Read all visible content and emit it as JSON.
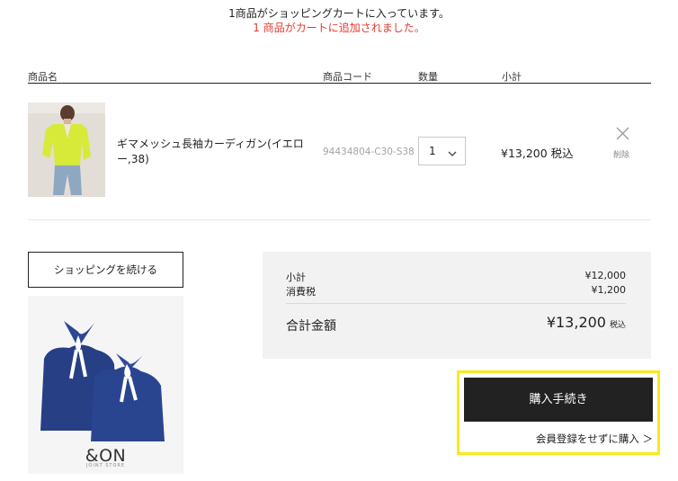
{
  "messages": {
    "items_in_cart": "1商品がショッピングカートに入っています。",
    "added_to_cart": "1 商品がカートに追加されました。",
    "added_color": "#e23a2e"
  },
  "table_header": {
    "name": "商品名",
    "code": "商品コード",
    "qty": "数量",
    "subtotal": "小計"
  },
  "item": {
    "name": "ギマメッシュ長袖カーディガン(イエロー,38)",
    "code": "94434804-C30-S38",
    "quantity": "1",
    "price": "¥13,200 税込",
    "delete_label": "削除"
  },
  "actions": {
    "continue_shopping": "ショッピングを続ける",
    "checkout": "購入手続き",
    "guest_checkout": "会員登録をせずに購入 ＞"
  },
  "banner": {
    "logo": "&ON",
    "sub": "JOINT STORE"
  },
  "summary": {
    "subtotal_label": "小計",
    "subtotal_value": "¥12,000",
    "tax_label": "消費税",
    "tax_value": "¥1,200",
    "total_label": "合計金額",
    "total_value": "¥13,200",
    "total_tax_note": "税込"
  },
  "colors": {
    "highlight": "#f7ea1f",
    "primary_button": "#222222"
  }
}
